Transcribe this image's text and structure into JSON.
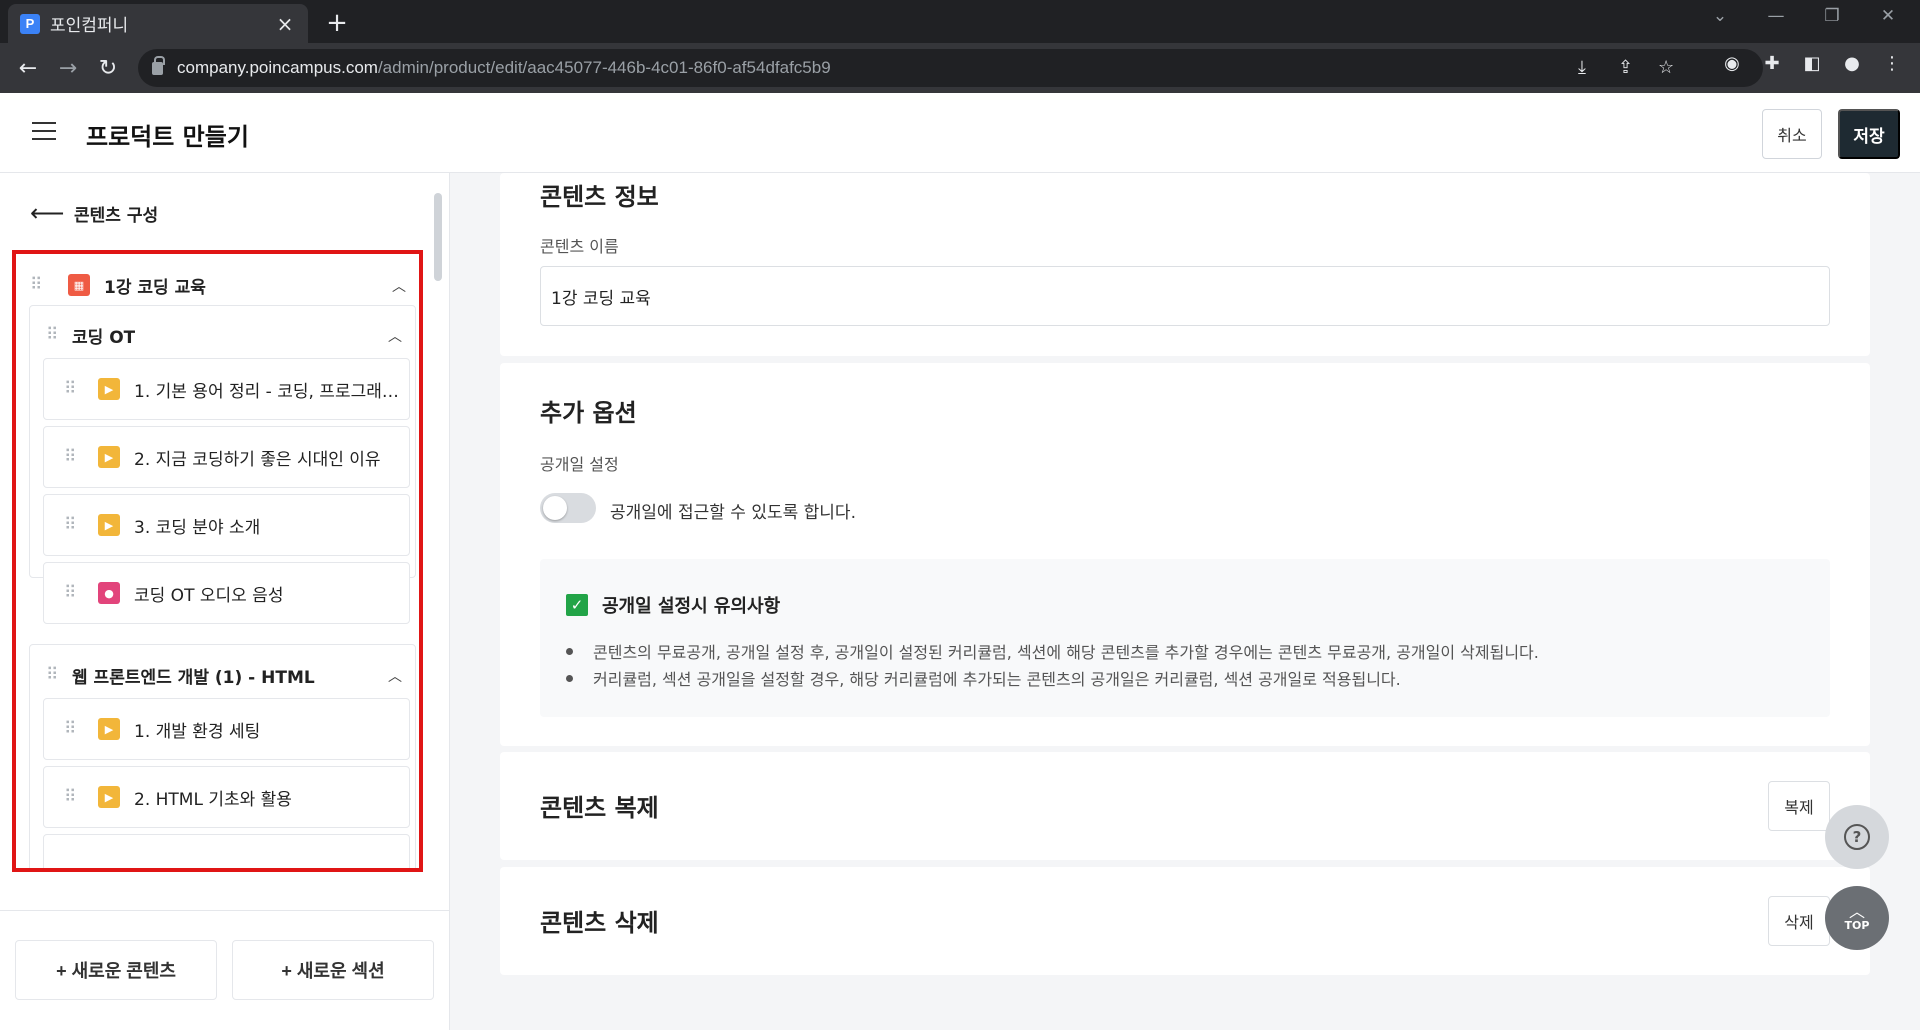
{
  "browser": {
    "tab_title": "포인컴퍼니",
    "tab_favicon": "P",
    "url_host": "company.poincampus.com",
    "url_path": "/admin/product/edit/aac45077-446b-4c01-86f0-af54dfafc5b9"
  },
  "header": {
    "title": "프로덕트 만들기",
    "cancel_label": "취소",
    "save_label": "저장"
  },
  "sidebar": {
    "back_label": "콘텐츠 구성",
    "course": {
      "label": "1강 코딩 교육"
    },
    "sections": [
      {
        "label": "코딩 OT",
        "items": [
          {
            "label": "1. 기본 용어 정리 - 코딩, 프로그래밍...",
            "type": "video"
          },
          {
            "label": "2. 지금 코딩하기 좋은 시대인 이유",
            "type": "video"
          },
          {
            "label": "3. 코딩 분야 소개",
            "type": "video"
          },
          {
            "label": "코딩 OT 오디오 음성",
            "type": "audio"
          }
        ]
      },
      {
        "label": "웹 프론트엔드 개발 (1) - HTML",
        "items": [
          {
            "label": "1. 개발 환경 세팅",
            "type": "video"
          },
          {
            "label": "2. HTML 기초와 활용",
            "type": "video"
          }
        ]
      }
    ],
    "new_content_label": "+ 새로운 콘텐츠",
    "new_section_label": "+ 새로운 섹션"
  },
  "content_info": {
    "title": "콘텐츠 정보",
    "name_label": "콘텐츠 이름",
    "name_value": "1강 코딩 교육"
  },
  "extra_options": {
    "title": "추가 옵션",
    "release_label": "공개일 설정",
    "toggle_label": "공개일에 접근할 수 있도록 합니다.",
    "toggle_on": false,
    "notice_title": "공개일 설정시 유의사항",
    "notice_items": [
      "콘텐츠의 무료공개, 공개일 설정 후, 공개일이 설정된 커리큘럼, 섹션에 해당 콘텐츠를 추가할 경우에는 콘텐츠 무료공개, 공개일이 삭제됩니다.",
      "커리큘럼, 섹션 공개일을 설정할 경우, 해당 커리큘럼에 추가되는 콘텐츠의 공개일은 커리큘럼, 섹션 공개일로 적용됩니다."
    ]
  },
  "duplicate": {
    "title": "콘텐츠 복제",
    "button": "복제"
  },
  "delete": {
    "title": "콘텐츠 삭제",
    "button": "삭제"
  },
  "fab": {
    "top_label": "TOP"
  },
  "colors": {
    "save_button": "#1e2a32",
    "highlight_border": "#e01515",
    "video_icon": "#f2b63a",
    "audio_icon": "#e2447b",
    "course_icon": "#ef5b44",
    "check": "#22a447"
  }
}
